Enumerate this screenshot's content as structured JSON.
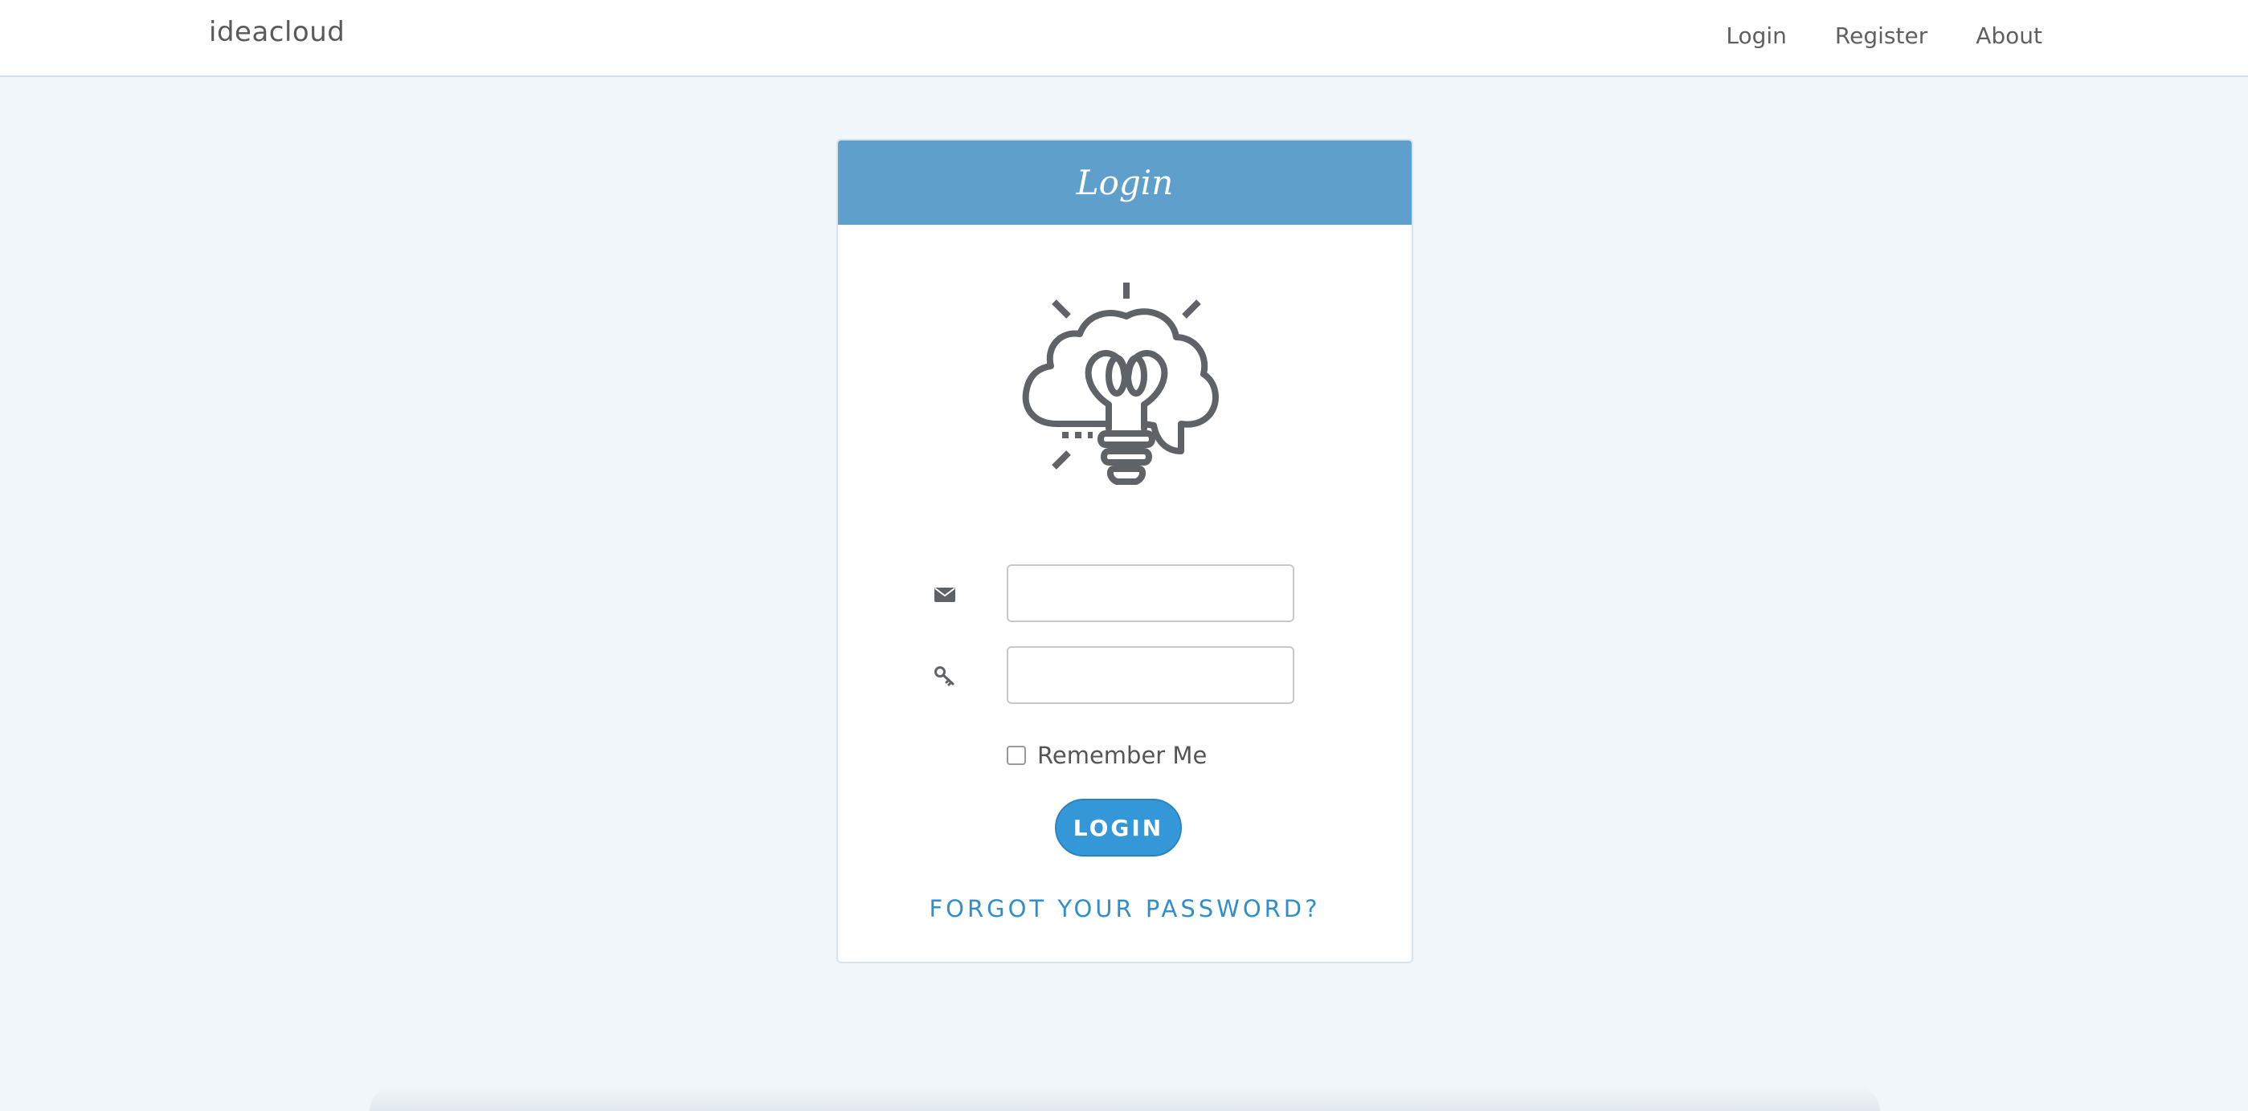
{
  "navbar": {
    "brand": "ideacloud",
    "links": [
      {
        "label": "Login"
      },
      {
        "label": "Register"
      },
      {
        "label": "About"
      }
    ]
  },
  "login_card": {
    "title": "Login",
    "logo_icon": "lightbulb-cloud-icon",
    "email_icon": "envelope-icon",
    "password_icon": "key-icon",
    "email_value": "",
    "password_value": "",
    "remember_label": "Remember Me",
    "remember_checked": false,
    "submit_label": "LOGIN",
    "forgot_label": "FORGOT YOUR PASSWORD?"
  },
  "colors": {
    "header": "#5e9fcb",
    "button": "#3498d8",
    "link": "#2f8ecc",
    "background": "#f1f6fa"
  }
}
